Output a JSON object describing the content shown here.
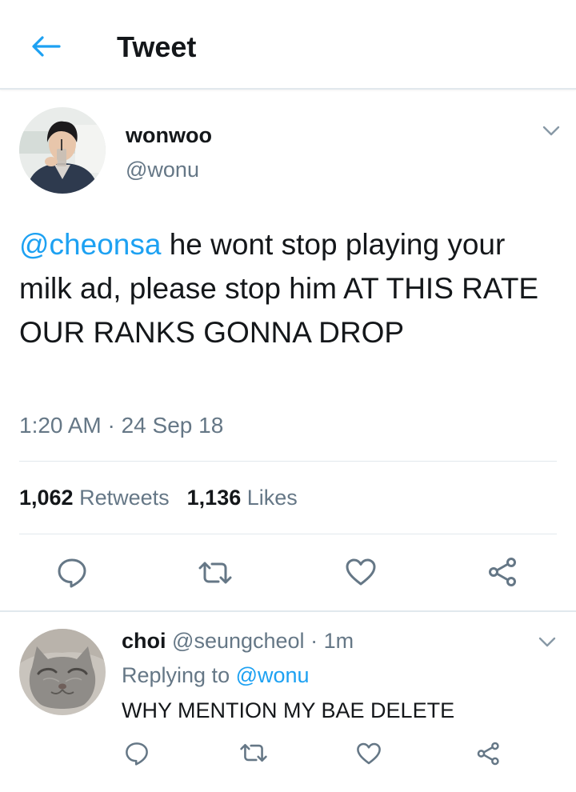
{
  "header": {
    "title": "Tweet"
  },
  "tweet": {
    "name": "wonwoo",
    "handle": "@wonu",
    "mention": "@cheonsa",
    "text": " he wont stop playing your milk ad, please stop him AT THIS RATE OUR RANKS GONNA DROP",
    "timestamp": "1:20 AM · 24 Sep 18",
    "retweets_count": "1,062",
    "retweets_label": "Retweets",
    "likes_count": "1,136",
    "likes_label": "Likes"
  },
  "reply": {
    "name": "choi",
    "handle": "@seungcheol",
    "separator": " · ",
    "time": "1m",
    "replying_prefix": "Replying to ",
    "replying_to": "@wonu",
    "text": "WHY MENTION MY BAE DELETE"
  },
  "icons": {
    "back": "arrow-left-icon",
    "caret": "chevron-down-icon",
    "reply": "comment-icon",
    "retweet": "retweet-icon",
    "like": "heart-icon",
    "share": "share-icon"
  },
  "colors": {
    "accent": "#1da1f2",
    "text": "#14171a",
    "secondary": "#657786",
    "border": "#e1e8ed"
  }
}
